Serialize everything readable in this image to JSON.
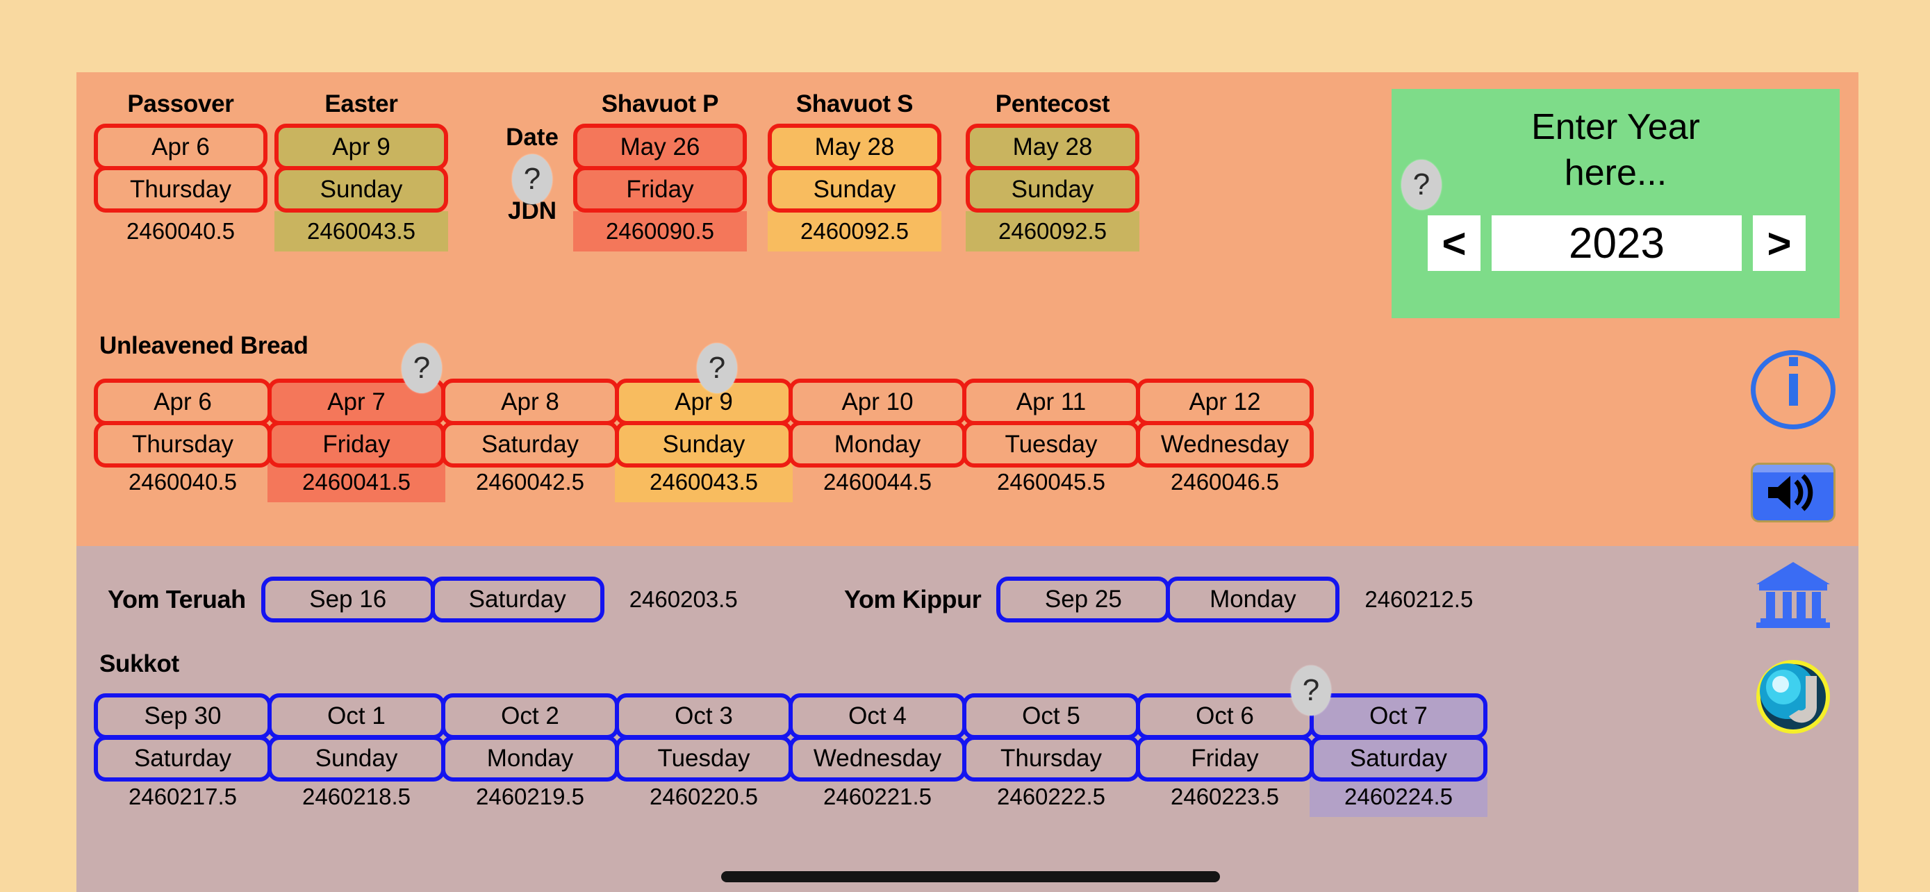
{
  "page": {
    "background": "#f9d9a0",
    "spring_panel_color": "#f5a87c",
    "fall_panel_color": "#c9aeae"
  },
  "spring": {
    "date_label": "Date",
    "jdn_label": "JDN",
    "help_glyph": "?",
    "columns": [
      {
        "name": "Passover",
        "date": "Apr 6",
        "weekday": "Thursday",
        "jdn": "2460040.5",
        "fill": "transparent"
      },
      {
        "name": "Easter",
        "date": "Apr 9",
        "weekday": "Sunday",
        "jdn": "2460043.5",
        "fill": "#c9b45f"
      },
      {
        "name": "Shavuot P",
        "date": "May 26",
        "weekday": "Friday",
        "jdn": "2460090.5",
        "fill": "#f4775a"
      },
      {
        "name": "Shavuot S",
        "date": "May 28",
        "weekday": "Sunday",
        "jdn": "2460092.5",
        "fill": "#f8bc5f"
      },
      {
        "name": "Pentecost",
        "date": "May 28",
        "weekday": "Sunday",
        "jdn": "2460092.5",
        "fill": "#c9b45f"
      }
    ]
  },
  "unleavened": {
    "title": "Unleavened Bread",
    "days": [
      {
        "date": "Apr 6",
        "weekday": "Thursday",
        "jdn": "2460040.5",
        "fill": "transparent"
      },
      {
        "date": "Apr 7",
        "weekday": "Friday",
        "jdn": "2460041.5",
        "fill": "#f4775a"
      },
      {
        "date": "Apr 8",
        "weekday": "Saturday",
        "jdn": "2460042.5",
        "fill": "transparent"
      },
      {
        "date": "Apr 9",
        "weekday": "Sunday",
        "jdn": "2460043.5",
        "fill": "#f8bc5f"
      },
      {
        "date": "Apr 10",
        "weekday": "Monday",
        "jdn": "2460044.5",
        "fill": "transparent"
      },
      {
        "date": "Apr 11",
        "weekday": "Tuesday",
        "jdn": "2460045.5",
        "fill": "transparent"
      },
      {
        "date": "Apr 12",
        "weekday": "Wednesday",
        "jdn": "2460046.5",
        "fill": "transparent"
      }
    ]
  },
  "fall": {
    "yom_teruah": {
      "label": "Yom Teruah",
      "date": "Sep 16",
      "weekday": "Saturday",
      "jdn": "2460203.5"
    },
    "yom_kippur": {
      "label": "Yom Kippur",
      "date": "Sep 25",
      "weekday": "Monday",
      "jdn": "2460212.5"
    },
    "sukkot_title": "Sukkot",
    "sukkot": [
      {
        "date": "Sep 30",
        "weekday": "Saturday",
        "jdn": "2460217.5",
        "fill": "transparent"
      },
      {
        "date": "Oct 1",
        "weekday": "Sunday",
        "jdn": "2460218.5",
        "fill": "transparent"
      },
      {
        "date": "Oct 2",
        "weekday": "Monday",
        "jdn": "2460219.5",
        "fill": "transparent"
      },
      {
        "date": "Oct 3",
        "weekday": "Tuesday",
        "jdn": "2460220.5",
        "fill": "transparent"
      },
      {
        "date": "Oct 4",
        "weekday": "Wednesday",
        "jdn": "2460221.5",
        "fill": "transparent"
      },
      {
        "date": "Oct 5",
        "weekday": "Thursday",
        "jdn": "2460222.5",
        "fill": "transparent"
      },
      {
        "date": "Oct 6",
        "weekday": "Friday",
        "jdn": "2460223.5",
        "fill": "transparent"
      },
      {
        "date": "Oct 7",
        "weekday": "Saturday",
        "jdn": "2460224.5",
        "fill": "#b3a1c7"
      }
    ]
  },
  "year_panel": {
    "title_line1": "Enter Year",
    "title_line2": "here...",
    "help_glyph": "?",
    "prev_label": "<",
    "next_label": ">",
    "year_value": "2023",
    "background": "#7edc89"
  },
  "rail": {
    "items": [
      {
        "icon": "info-icon"
      },
      {
        "icon": "sound-icon"
      },
      {
        "icon": "temple-icon"
      },
      {
        "icon": "globe-j-icon"
      }
    ]
  }
}
